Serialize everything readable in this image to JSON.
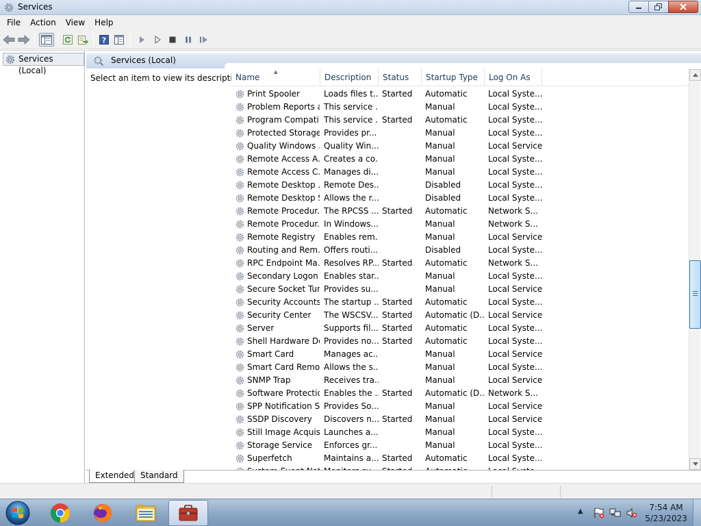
{
  "window": {
    "title": "Services",
    "icon": "services-gear-icon"
  },
  "menu": [
    "File",
    "Action",
    "View",
    "Help"
  ],
  "toolbar": {
    "buttons": [
      "back-icon",
      "forward-icon",
      "show-hide-console-tree-icon",
      "refresh-icon",
      "export-list-icon",
      "help-icon",
      "properties-icon",
      "start-service-icon",
      "start-service-alt-icon",
      "stop-service-icon",
      "pause-service-icon",
      "restart-service-icon"
    ]
  },
  "tree": {
    "root_label": "Services (Local)"
  },
  "main": {
    "header_title": "Services (Local)",
    "description_prompt": "Select an item to view its description.",
    "columns": {
      "name": "Name",
      "description": "Description",
      "status": "Status",
      "startup_type": "Startup Type",
      "log_on_as": "Log On As"
    },
    "sorted_column": "Name",
    "sort_direction": "ascending",
    "scroll_position": 0.58,
    "services": [
      {
        "name": "Print Spooler",
        "description": "Loads files t...",
        "status": "Started",
        "startup": "Automatic",
        "logon": "Local Syste..."
      },
      {
        "name": "Problem Reports a...",
        "description": "This service ...",
        "status": "",
        "startup": "Manual",
        "logon": "Local Syste..."
      },
      {
        "name": "Program Compati...",
        "description": "This service ...",
        "status": "Started",
        "startup": "Automatic",
        "logon": "Local Syste..."
      },
      {
        "name": "Protected Storage",
        "description": "Provides pr...",
        "status": "",
        "startup": "Manual",
        "logon": "Local Syste..."
      },
      {
        "name": "Quality Windows ...",
        "description": "Quality Win...",
        "status": "",
        "startup": "Manual",
        "logon": "Local Service"
      },
      {
        "name": "Remote Access A...",
        "description": "Creates a co...",
        "status": "",
        "startup": "Manual",
        "logon": "Local Syste..."
      },
      {
        "name": "Remote Access C...",
        "description": "Manages di...",
        "status": "",
        "startup": "Manual",
        "logon": "Local Syste..."
      },
      {
        "name": "Remote Desktop ...",
        "description": "Remote Des...",
        "status": "",
        "startup": "Disabled",
        "logon": "Local Syste..."
      },
      {
        "name": "Remote Desktop S...",
        "description": "Allows the r...",
        "status": "",
        "startup": "Disabled",
        "logon": "Local Syste..."
      },
      {
        "name": "Remote Procedur...",
        "description": "The RPCSS ...",
        "status": "Started",
        "startup": "Automatic",
        "logon": "Network S..."
      },
      {
        "name": "Remote Procedur...",
        "description": "In Windows...",
        "status": "",
        "startup": "Manual",
        "logon": "Network S..."
      },
      {
        "name": "Remote Registry",
        "description": "Enables rem...",
        "status": "",
        "startup": "Manual",
        "logon": "Local Service"
      },
      {
        "name": "Routing and Rem...",
        "description": "Offers routi...",
        "status": "",
        "startup": "Disabled",
        "logon": "Local Syste..."
      },
      {
        "name": "RPC Endpoint Ma...",
        "description": "Resolves RP...",
        "status": "Started",
        "startup": "Automatic",
        "logon": "Network S..."
      },
      {
        "name": "Secondary Logon",
        "description": "Enables star...",
        "status": "",
        "startup": "Manual",
        "logon": "Local Syste..."
      },
      {
        "name": "Secure Socket Tun...",
        "description": "Provides su...",
        "status": "",
        "startup": "Manual",
        "logon": "Local Service"
      },
      {
        "name": "Security Accounts...",
        "description": "The startup ...",
        "status": "Started",
        "startup": "Automatic",
        "logon": "Local Syste..."
      },
      {
        "name": "Security Center",
        "description": "The WSCSV...",
        "status": "Started",
        "startup": "Automatic (D...",
        "logon": "Local Service"
      },
      {
        "name": "Server",
        "description": "Supports fil...",
        "status": "Started",
        "startup": "Automatic",
        "logon": "Local Syste..."
      },
      {
        "name": "Shell Hardware De...",
        "description": "Provides no...",
        "status": "Started",
        "startup": "Automatic",
        "logon": "Local Syste..."
      },
      {
        "name": "Smart Card",
        "description": "Manages ac...",
        "status": "",
        "startup": "Manual",
        "logon": "Local Service"
      },
      {
        "name": "Smart Card Remo...",
        "description": "Allows the s...",
        "status": "",
        "startup": "Manual",
        "logon": "Local Syste..."
      },
      {
        "name": "SNMP Trap",
        "description": "Receives tra...",
        "status": "",
        "startup": "Manual",
        "logon": "Local Service"
      },
      {
        "name": "Software Protection",
        "description": "Enables the ...",
        "status": "Started",
        "startup": "Automatic (D...",
        "logon": "Network S..."
      },
      {
        "name": "SPP Notification S...",
        "description": "Provides So...",
        "status": "",
        "startup": "Manual",
        "logon": "Local Service"
      },
      {
        "name": "SSDP Discovery",
        "description": "Discovers n...",
        "status": "Started",
        "startup": "Manual",
        "logon": "Local Service"
      },
      {
        "name": "Still Image Acquisi...",
        "description": "Launches a...",
        "status": "",
        "startup": "Manual",
        "logon": "Local Syste..."
      },
      {
        "name": "Storage Service",
        "description": "Enforces gr...",
        "status": "",
        "startup": "Manual",
        "logon": "Local Syste..."
      },
      {
        "name": "Superfetch",
        "description": "Maintains a...",
        "status": "Started",
        "startup": "Automatic",
        "logon": "Local Syste..."
      },
      {
        "name": "System Event Noti...",
        "description": "Monitors sy...",
        "status": "Started",
        "startup": "Automatic",
        "logon": "Local Syste..."
      }
    ]
  },
  "tabs": [
    {
      "label": "Extended",
      "active": true
    },
    {
      "label": "Standard",
      "active": false
    }
  ],
  "taskbar": {
    "start": "windows-start-orb",
    "pinned": [
      "chrome-icon",
      "firefox-icon",
      "file-explorer-icon",
      "toolbox-icon"
    ],
    "active_index": 3,
    "tray_icons": [
      "action-center-flag-icon",
      "network-icon",
      "volume-muted-icon"
    ],
    "time": "7:54 AM",
    "date": "5/23/2023"
  },
  "colors": {
    "header_text": "#1e395b",
    "selection_bg": "#e9eef5",
    "scroll_thumb": "#bcdcf4"
  }
}
